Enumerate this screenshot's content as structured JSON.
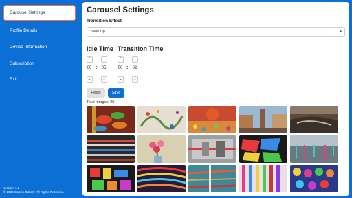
{
  "sidebar": {
    "items": [
      {
        "label": "Carousel Settings",
        "active": true
      },
      {
        "label": "Profile Details",
        "active": false
      },
      {
        "label": "Device Information",
        "active": false
      },
      {
        "label": "Subscription",
        "active": false
      },
      {
        "label": "Exit",
        "active": false
      }
    ],
    "version": "version: 1.2",
    "copyright": "© 2025 Screen Gallery. All Rights Reserved."
  },
  "main": {
    "title": "Carousel Settings",
    "transition_effect_label": "Transition Effect",
    "transition_effect_value": "Slide Up",
    "idle_time": {
      "label": "Idle Time",
      "minutes": "00",
      "seconds": "05"
    },
    "transition_time": {
      "label": "Transition Time",
      "minutes": "00",
      "seconds": "02"
    },
    "reset_label": "Reset",
    "save_label": "Save",
    "total_images": "Total Images: 20",
    "thumbnails": [
      "Abstract with colorful leaf shapes",
      "Paint strokes and dots",
      "Colorful dabs with red dome",
      "Street with tower",
      "Dark smeared abstract",
      "Dark streaked abstract",
      "Pink flowers in vase",
      "Blurry gray abstract",
      "Stained glass lines",
      "Teal ink drips",
      "Color blocks on black",
      "Wavy color stripes",
      "Teal and red streaks",
      "Vertical color drips",
      "Multicolor circles"
    ]
  }
}
